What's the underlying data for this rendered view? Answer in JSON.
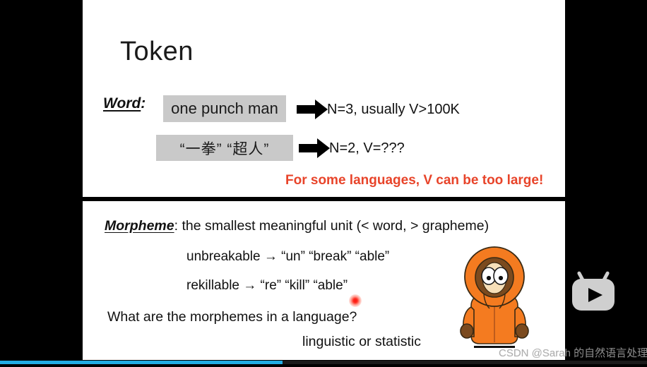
{
  "player": {
    "logo_name": "bilibili-logo",
    "progress_percent": 44,
    "progress_color": "#22ace3",
    "watermark_white_part": "CSDN @Sara",
    "watermark_dark_part": "h 的自然语言处理",
    "watermark_full": "CSDN @Sarah 的自然语言处理"
  },
  "slide": {
    "title": "Token",
    "word_section": {
      "label": "Word",
      "label_suffix": ":",
      "rows": [
        {
          "box_text": "one punch man",
          "arrow": "right-arrow-icon",
          "result": "N=3, usually V>100K"
        },
        {
          "box_text": "“一拳”  “超人”",
          "arrow": "right-arrow-icon",
          "result": "N=2, V=???"
        }
      ],
      "warning": "For some languages, V can be too large!",
      "warning_color": "#e8442a"
    },
    "morpheme_section": {
      "head": "Morpheme",
      "definition": ": the smallest meaningful unit  (< word, > grapheme)",
      "examples": [
        "unbreakable → “un” “break” “able”",
        "rekillable → “re” “kill” “able”"
      ],
      "question": "What are the morphemes in a language?",
      "answer": "linguistic or statistic",
      "image_name": "kenny-south-park-character"
    }
  },
  "pointer": {
    "name": "laser-pointer-dot",
    "color": "#ff1111"
  }
}
